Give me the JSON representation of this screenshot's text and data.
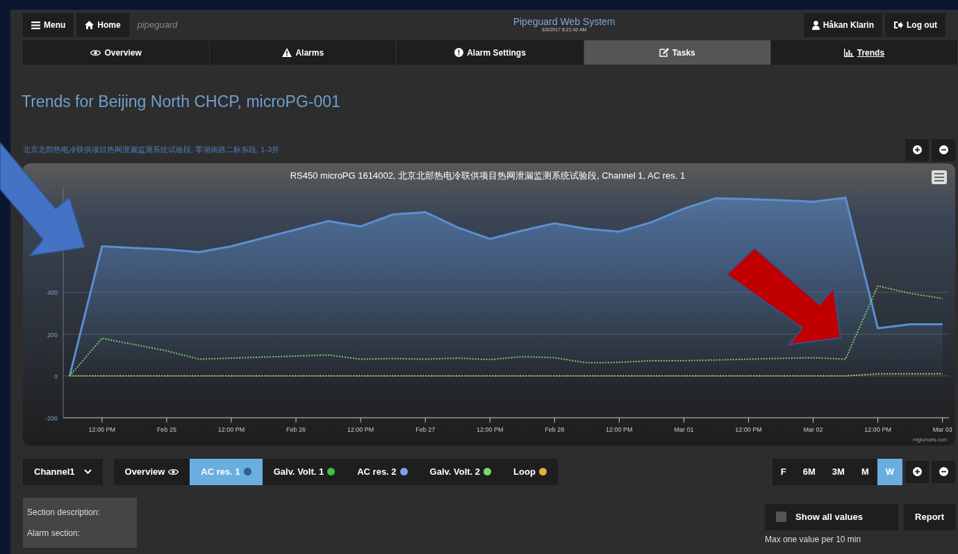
{
  "header": {
    "menu_button": "Menu",
    "home_button": "Home",
    "logo": "pipeguard",
    "title": "Pipeguard Web System",
    "datetime": "3/3/2017 6:21:42 AM",
    "user_button": "Håkan Klarin",
    "logout_button": "Log out"
  },
  "tabs": [
    {
      "label": "Overview",
      "selected": false,
      "underlined": false
    },
    {
      "label": "Alarms",
      "selected": false,
      "underlined": false
    },
    {
      "label": "Alarm Settings",
      "selected": false,
      "underlined": false
    },
    {
      "label": "Tasks",
      "selected": true,
      "underlined": false
    },
    {
      "label": "Trends",
      "selected": false,
      "underlined": true
    }
  ],
  "page_title": "Trends for Beijing North CHCP, microPG-001",
  "subtitle": "北京北部热电冷联供项目热网泄漏监测系统试验段, 零湖南路二标东段, 1-3井",
  "chart": {
    "credit": "Highcharts.com",
    "chart_data": {
      "type": "area",
      "grid": true,
      "title": "RS450 microPG 1614002, 北京北部热电冷联供项目热网泄漏监测系统试验段, Channel 1, AC res. 1",
      "categories": [
        null,
        "12:00 PM",
        null,
        "Feb 25",
        null,
        "12:00 PM",
        null,
        "Feb 26",
        null,
        "12:00 PM",
        null,
        "Feb 27",
        null,
        "12:00 PM",
        null,
        "Feb 28",
        null,
        "12:00 PM",
        null,
        "Mar 01",
        null,
        "12:00 PM",
        null,
        "Mar 02",
        null,
        "12:00 PM",
        null,
        "Mar 03"
      ],
      "series": [
        {
          "color": "#5b8fd0",
          "values": [
            0,
            620,
            612,
            605,
            592,
            620,
            660,
            700,
            740,
            715,
            772,
            783,
            710,
            655,
            695,
            730,
            703,
            690,
            735,
            800,
            849,
            845,
            840,
            833,
            852,
            228,
            247,
            247
          ]
        },
        {
          "type": "line",
          "line_style": "dotted",
          "color": "#7ccc6a",
          "values": [
            0,
            180,
            150,
            120,
            80,
            85,
            90,
            95,
            100,
            80,
            83,
            80,
            85,
            78,
            92,
            87,
            63,
            65,
            73,
            73,
            76,
            80,
            84,
            87,
            80,
            430,
            395,
            370
          ]
        },
        {
          "type": "line",
          "line_style": "dotted",
          "color": "#d8c070",
          "values": [
            0,
            0,
            0,
            0,
            0,
            0,
            0,
            0,
            0,
            0,
            0,
            0,
            0,
            0,
            0,
            0,
            0,
            0,
            0,
            0,
            0,
            0,
            0,
            0,
            0,
            10,
            10,
            10
          ]
        }
      ],
      "ylim": [
        -200,
        900
      ],
      "yticks": [
        -200,
        0,
        200,
        400
      ]
    }
  },
  "channel_select": "Channel1",
  "series_buttons": [
    {
      "label": "Overview",
      "kind": "eye",
      "selected": false
    },
    {
      "label": "AC res. 1",
      "kind": "dot",
      "color": "#2f5f8f",
      "selected": true
    },
    {
      "label": "Galv. Volt. 1",
      "kind": "dot",
      "color": "#3fc03f",
      "selected": false
    },
    {
      "label": "AC res. 2",
      "kind": "dot",
      "color": "#7f9fef",
      "selected": false
    },
    {
      "label": "Galv. Volt. 2",
      "kind": "dot",
      "color": "#6fdf6f",
      "selected": false
    },
    {
      "label": "Loop",
      "kind": "dot",
      "color": "#e0b040",
      "selected": false
    }
  ],
  "ranges": [
    {
      "label": "F",
      "selected": false
    },
    {
      "label": "6M",
      "selected": false
    },
    {
      "label": "3M",
      "selected": false
    },
    {
      "label": "M",
      "selected": false
    },
    {
      "label": "W",
      "selected": true
    }
  ],
  "section_info": [
    "Section description:",
    "Alarm section:"
  ],
  "show_all_values": {
    "label": "Show all values",
    "checked": false
  },
  "report_button": "Report",
  "note": "Max one value per 10 min"
}
